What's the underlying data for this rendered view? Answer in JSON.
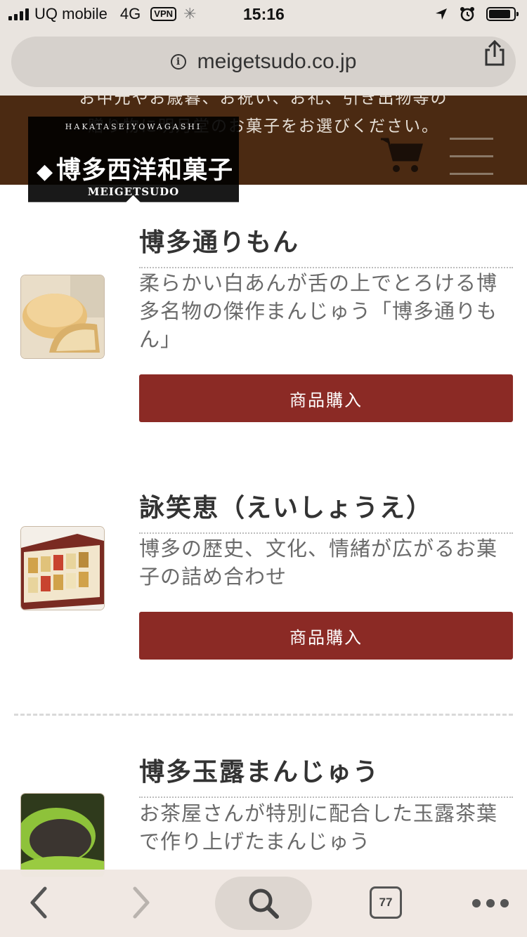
{
  "status_bar": {
    "carrier": "UQ mobile",
    "network": "4G",
    "vpn": "VPN",
    "time": "15:16"
  },
  "browser": {
    "url": "meigetsudo.co.jp",
    "tab_count": "77"
  },
  "site": {
    "header_text_line1": "お中元やお歳暮、お祝い、お礼、引き出物等の",
    "header_text_line2": "贈り物に明月堂のお菓子をお選びください。",
    "logo": {
      "arc_text": "HAKATASEIYOWAGASHI",
      "main_text": "博多西洋和菓子",
      "sub_text": "MEIGETSUDO"
    }
  },
  "products": [
    {
      "title": "博多通りもん",
      "description": "柔らかい白あんが舌の上でとろける博多名物の傑作まんじゅう「博多通りもん」",
      "button_label": "商品購入"
    },
    {
      "title": "詠笑恵（えいしょうえ）",
      "description": "博多の歴史、文化、情緒が広がるお菓子の詰め合わせ",
      "button_label": "商品購入"
    },
    {
      "title": "博多玉露まんじゅう",
      "description": "お茶屋さんが特別に配合した玉露茶葉で作り上げたまんじゅう"
    }
  ],
  "icons": {
    "info": "info-icon",
    "share": "share-icon",
    "cart": "cart-icon",
    "menu": "hamburger-menu-icon",
    "back": "back-icon",
    "forward": "forward-icon",
    "search": "search-icon",
    "tabs": "tabs-icon",
    "more": "more-icon"
  },
  "colors": {
    "header_bg": "#4b2a12",
    "button_bg": "#8b2a25",
    "status_bg": "#e9e4df"
  }
}
